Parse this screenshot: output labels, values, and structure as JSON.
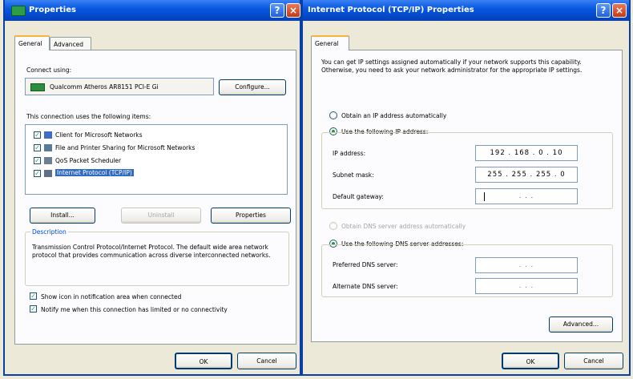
{
  "left_window": {
    "title": "Properties",
    "tabs": [
      "General",
      "Advanced"
    ],
    "connect_using_label": "Connect using:",
    "adapter_name": "Qualcomm Atheros AR8151 PCI-E Gi",
    "configure_label": "Configure...",
    "items_label": "This connection uses the following items:",
    "items": [
      {
        "label": "Client for Microsoft Networks",
        "checked": true
      },
      {
        "label": "File and Printer Sharing for Microsoft Networks",
        "checked": true
      },
      {
        "label": "QoS Packet Scheduler",
        "checked": true
      },
      {
        "label": "Internet Protocol (TCP/IP)",
        "checked": true,
        "selected": true
      }
    ],
    "install_label": "Install...",
    "uninstall_label": "Uninstall",
    "properties_label": "Properties",
    "description_title": "Description",
    "description_text": "Transmission Control Protocol/Internet Protocol. The default wide area network protocol that provides communication across diverse interconnected networks.",
    "show_icon_label": "Show icon in notification area when connected",
    "notify_label": "Notify me when this connection has limited or no connectivity",
    "ok_label": "OK",
    "cancel_label": "Cancel"
  },
  "right_window": {
    "title": "Internet Protocol (TCP/IP) Properties",
    "tab": "General",
    "intro_text": "You can get IP settings assigned automatically if your network supports this capability. Otherwise, you need to ask your network administrator for the appropriate IP settings.",
    "obtain_auto_label": "Obtain an IP address automatically",
    "use_following_label": "Use the following IP address:",
    "ip_address_label": "IP address:",
    "ip_address_value": "192 . 168 . 0 . 10",
    "subnet_label": "Subnet mask:",
    "subnet_value": "255 . 255 . 255 . 0",
    "gateway_label": "Default gateway:",
    "gateway_value": ".       .       .",
    "obtain_dns_label": "Obtain DNS server address automatically",
    "use_dns_label": "Use the following DNS server addresses:",
    "preferred_dns_label": "Preferred DNS server:",
    "alternate_dns_label": "Alternate DNS server:",
    "dns_empty_value": ".       .       .",
    "advanced_label": "Advanced...",
    "ok_label": "OK",
    "cancel_label": "Cancel"
  }
}
